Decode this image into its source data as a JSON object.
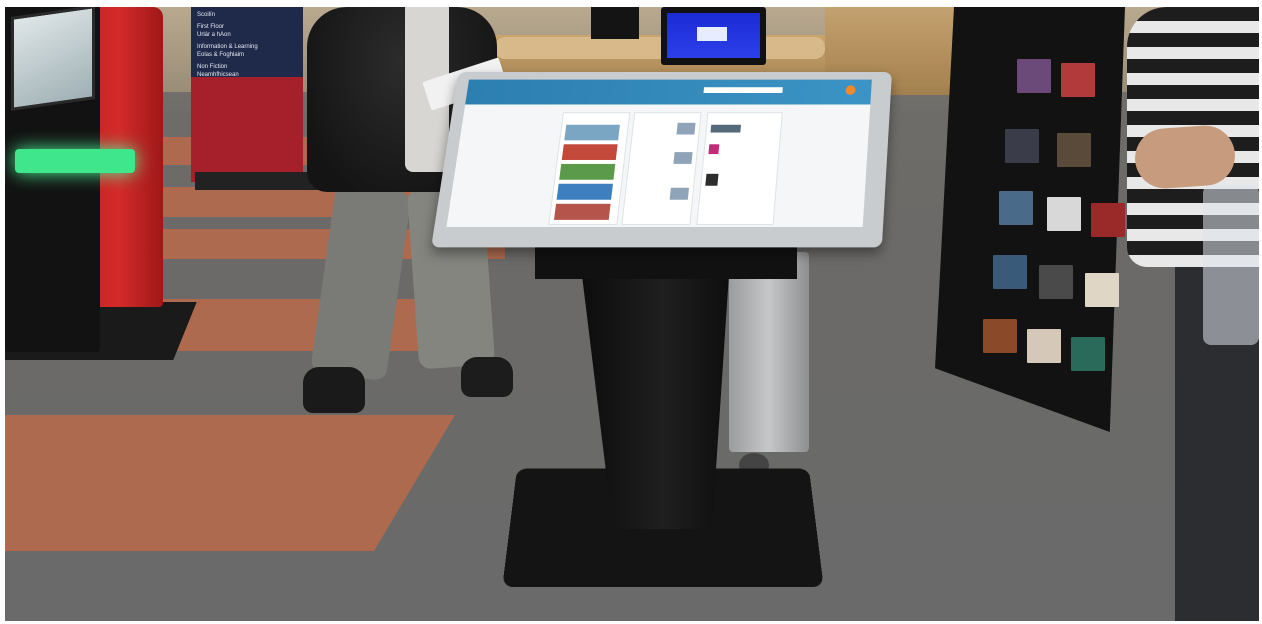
{
  "scene": {
    "banner_lines": [
      "Scoilín",
      "First Floor",
      "Urlár a hAon",
      "Information & Learning",
      "Eolas & Foghlaim",
      "Non Fiction",
      "Neamhfhicsean"
    ]
  }
}
